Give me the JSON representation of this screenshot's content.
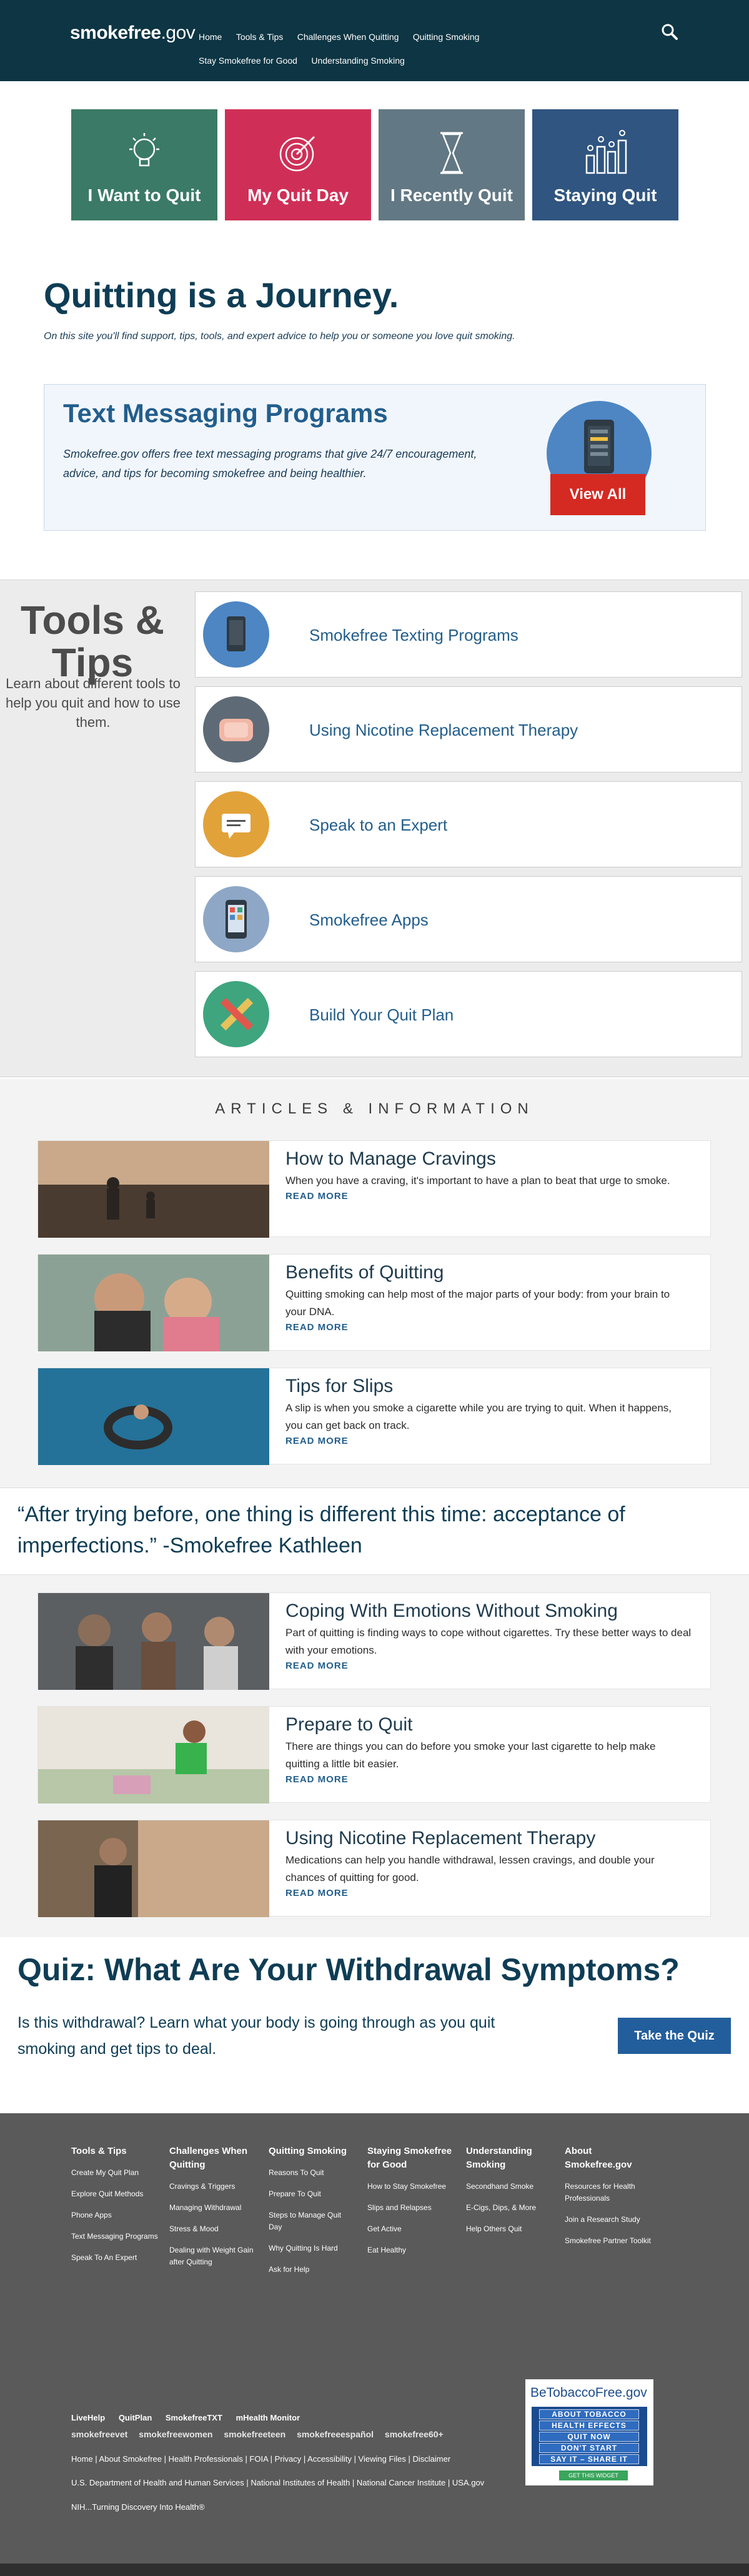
{
  "header": {
    "logo_main": "smokefree",
    "logo_suffix": ".gov",
    "nav": [
      "Home",
      "Tools & Tips",
      "Challenges When Quitting",
      "Quitting Smoking",
      "Stay Smokefree for Good",
      "Understanding Smoking"
    ],
    "search_icon": "search-icon"
  },
  "tiles": [
    {
      "label": "I Want to Quit",
      "icon": "lightbulb-icon",
      "color": "#3a7a66"
    },
    {
      "label": "My Quit Day",
      "icon": "target-icon",
      "color": "#cf2f57"
    },
    {
      "label": "I Recently Quit",
      "icon": "hourglass-icon",
      "color": "#627884"
    },
    {
      "label": "Staying Quit",
      "icon": "bar-chart-icon",
      "color": "#2f5580"
    }
  ],
  "journey": {
    "title": "Quitting is a Journey.",
    "subtitle": "On this site you'll find support, tips, tools, and expert advice to help you or someone you love quit smoking."
  },
  "texting": {
    "title": "Text Messaging Programs",
    "body": "Smokefree.gov offers free text messaging programs that give 24/7 encouragement, advice, and tips for becoming smokefree and being healthier.",
    "button": "View All"
  },
  "tools": {
    "title_1": "Tools &",
    "title_2": "Tips",
    "subtitle": "Learn about different tools to help you quit and how to use them.",
    "items": [
      {
        "label": "Smokefree Texting Programs",
        "icon": "phone-icon",
        "color": "#4d86c3"
      },
      {
        "label": "Using Nicotine Replacement Therapy",
        "icon": "patch-icon",
        "color": "#5e6b76"
      },
      {
        "label": "Speak to an Expert",
        "icon": "chat-bubble-icon",
        "color": "#e2a23a"
      },
      {
        "label": "Smokefree Apps",
        "icon": "app-phone-icon",
        "color": "#8ea7c6"
      },
      {
        "label": "Build Your Quit Plan",
        "icon": "pencil-ruler-icon",
        "color": "#3fa57f"
      }
    ]
  },
  "articles": {
    "heading": "ARTICLES & INFORMATION",
    "read_more": "READ MORE",
    "list": [
      {
        "title": "How to Manage Cravings",
        "body": "When you have a craving, it's important to have a plan to beat that urge to smoke."
      },
      {
        "title": "Benefits of Quitting",
        "body": "Quitting smoking can help most of the major parts of your body: from your brain to your DNA."
      },
      {
        "title": "Tips for Slips",
        "body": "A slip is when you smoke a cigarette while you are trying to quit. When it happens, you can get back on track."
      },
      {
        "title": "Coping With Emotions Without Smoking",
        "body": "Part of quitting is finding ways to cope without cigarettes. Try these better ways to deal with your emotions."
      },
      {
        "title": "Prepare to Quit",
        "body": "There are things you can do before you smoke your last cigarette to help make quitting a little bit easier."
      },
      {
        "title": "Using Nicotine Replacement Therapy",
        "body": "Medications can help you handle withdrawal, lessen cravings, and double your chances of quitting for good."
      }
    ]
  },
  "quote": "“After trying before, one thing is different this time: acceptance of imperfections.” -Smokefree Kathleen",
  "quiz": {
    "title": "Quiz: What Are Your Withdrawal Symptoms?",
    "text": "Is this withdrawal? Learn what your body is going through as you quit smoking and get tips to deal.",
    "button": "Take the Quiz"
  },
  "footer": {
    "columns": [
      {
        "title": "Tools & Tips",
        "links": [
          "Create My Quit Plan",
          "Explore Quit Methods",
          "Phone Apps",
          "Text Messaging Programs",
          "Speak To An Expert"
        ]
      },
      {
        "title": "Challenges When Quitting",
        "links": [
          "Cravings & Triggers",
          "Managing Withdrawal",
          "Stress & Mood",
          "Dealing with Weight Gain after Quitting"
        ]
      },
      {
        "title": "Quitting Smoking",
        "links": [
          "Reasons To Quit",
          "Prepare To Quit",
          "Steps to Manage Quit Day",
          "Why Quitting Is Hard",
          "Ask for Help"
        ]
      },
      {
        "title": "Staying Smokefree for Good",
        "links": [
          "How to Stay Smokefree",
          "Slips and Relapses",
          "Get Active",
          "Eat Healthy"
        ]
      },
      {
        "title": "Understanding Smoking",
        "links": [
          "Secondhand Smoke",
          "E-Cigs, Dips, & More",
          "Help Others Quit"
        ]
      },
      {
        "title": "About Smokefree.gov",
        "links": [
          "Resources for Health Professionals",
          "Join a Research Study",
          "Smokefree Partner Toolkit"
        ]
      }
    ],
    "row1": [
      "LiveHelp",
      "QuitPlan",
      "SmokefreeTXT",
      "mHealth Monitor"
    ],
    "brands": [
      "smokefreevet",
      "smokefreewomen",
      "smokefreeteen",
      "smokefreeespañol",
      "smokefree60+"
    ],
    "links": "Home  |  About Smokefree  |  Health Professionals  |  FOIA  |  Privacy  |  Accessibility  |  Viewing Files  |  Disclaimer",
    "links2": "U.S. Department of Health and Human Services  |  National Institutes of Health  |  National Cancer Institute  |  USA.gov",
    "nih": "NIH...Turning Discovery Into Health®",
    "widget": {
      "title": "BeTobaccoFree.gov",
      "rows": [
        "ABOUT TOBACCO",
        "HEALTH EFFECTS",
        "QUIT NOW",
        "DON'T START",
        "SAY IT – SHARE IT"
      ],
      "button": "GET THIS WIDGET"
    }
  }
}
